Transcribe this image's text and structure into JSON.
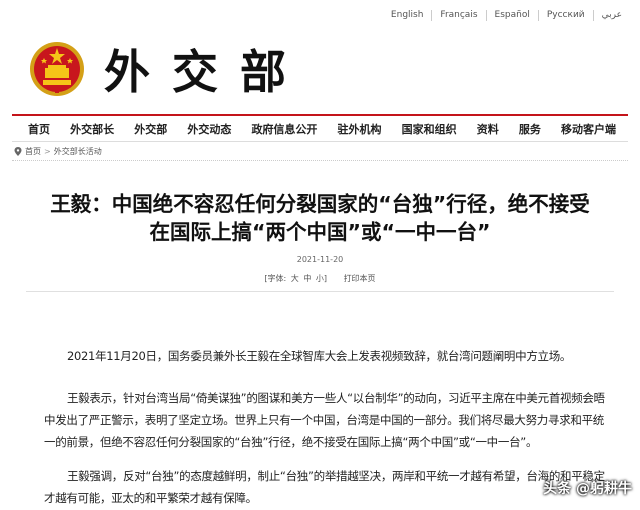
{
  "languages": [
    "English",
    "Français",
    "Español",
    "Русский",
    "عربي"
  ],
  "header": {
    "site_logo_text": "外交部"
  },
  "nav": {
    "items": [
      "首页",
      "外交部长",
      "外交部",
      "外交动态",
      "政府信息公开",
      "驻外机构",
      "国家和组织",
      "资料",
      "服务",
      "移动客户端"
    ]
  },
  "breadcrumb": {
    "home": "首页",
    "separator": ">",
    "section": "外交部长活动"
  },
  "article": {
    "title_line1": "王毅：中国绝不容忍任何分裂国家的“台独”行径，绝不接受",
    "title_line2": "在国际上搞“两个中国”或“一中一台”",
    "date": "2021-11-20",
    "font_label": "[字体:",
    "font_large": "大",
    "font_medium": "中",
    "font_small": "小]",
    "print": "打印本页",
    "paragraphs": [
      "2021年11月20日，国务委员兼外长王毅在全球智库大会上发表视频致辞，就台湾问题阐明中方立场。",
      "王毅表示，针对台湾当局“倚美谋独”的图谋和美方一些人“以台制华”的动向，习近平主席在中美元首视频会晤中发出了严正警示，表明了坚定立场。世界上只有一个中国，台湾是中国的一部分。我们将尽最大努力寻求和平统一的前景，但绝不容忍任何分裂国家的“台独”行径，绝不接受在国际上搞“两个中国”或“一中一台”。",
      "王毅强调，反对“台独”的态度越鲜明，制止“台独”的举措越坚决，两岸和平统一才越有希望，台海的和平稳定才越有可能，亚太的和平繁荣才越有保障。"
    ]
  },
  "watermark": "头条 @躬耕牛",
  "colors": {
    "accent": "#c4141a"
  }
}
